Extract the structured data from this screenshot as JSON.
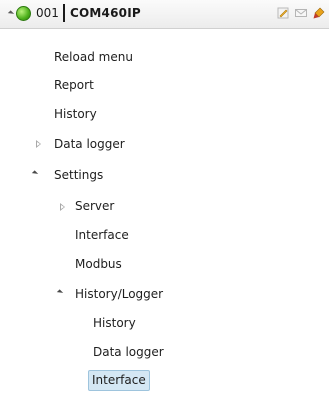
{
  "tree": {
    "root": {
      "id": "001",
      "name": "COM460IP",
      "status_color": "#4caf1a"
    },
    "items": [
      {
        "label": "Reload menu"
      },
      {
        "label": "Report"
      },
      {
        "label": "History"
      },
      {
        "label": "Data logger"
      },
      {
        "label": "Settings"
      },
      {
        "label": "Server"
      },
      {
        "label": "Interface"
      },
      {
        "label": "Modbus"
      },
      {
        "label": "History/Logger"
      },
      {
        "label": "History"
      },
      {
        "label": "Data logger"
      },
      {
        "label": "Interface"
      }
    ],
    "header_icons": [
      "edit-icon",
      "mail-icon",
      "brush-icon"
    ]
  }
}
